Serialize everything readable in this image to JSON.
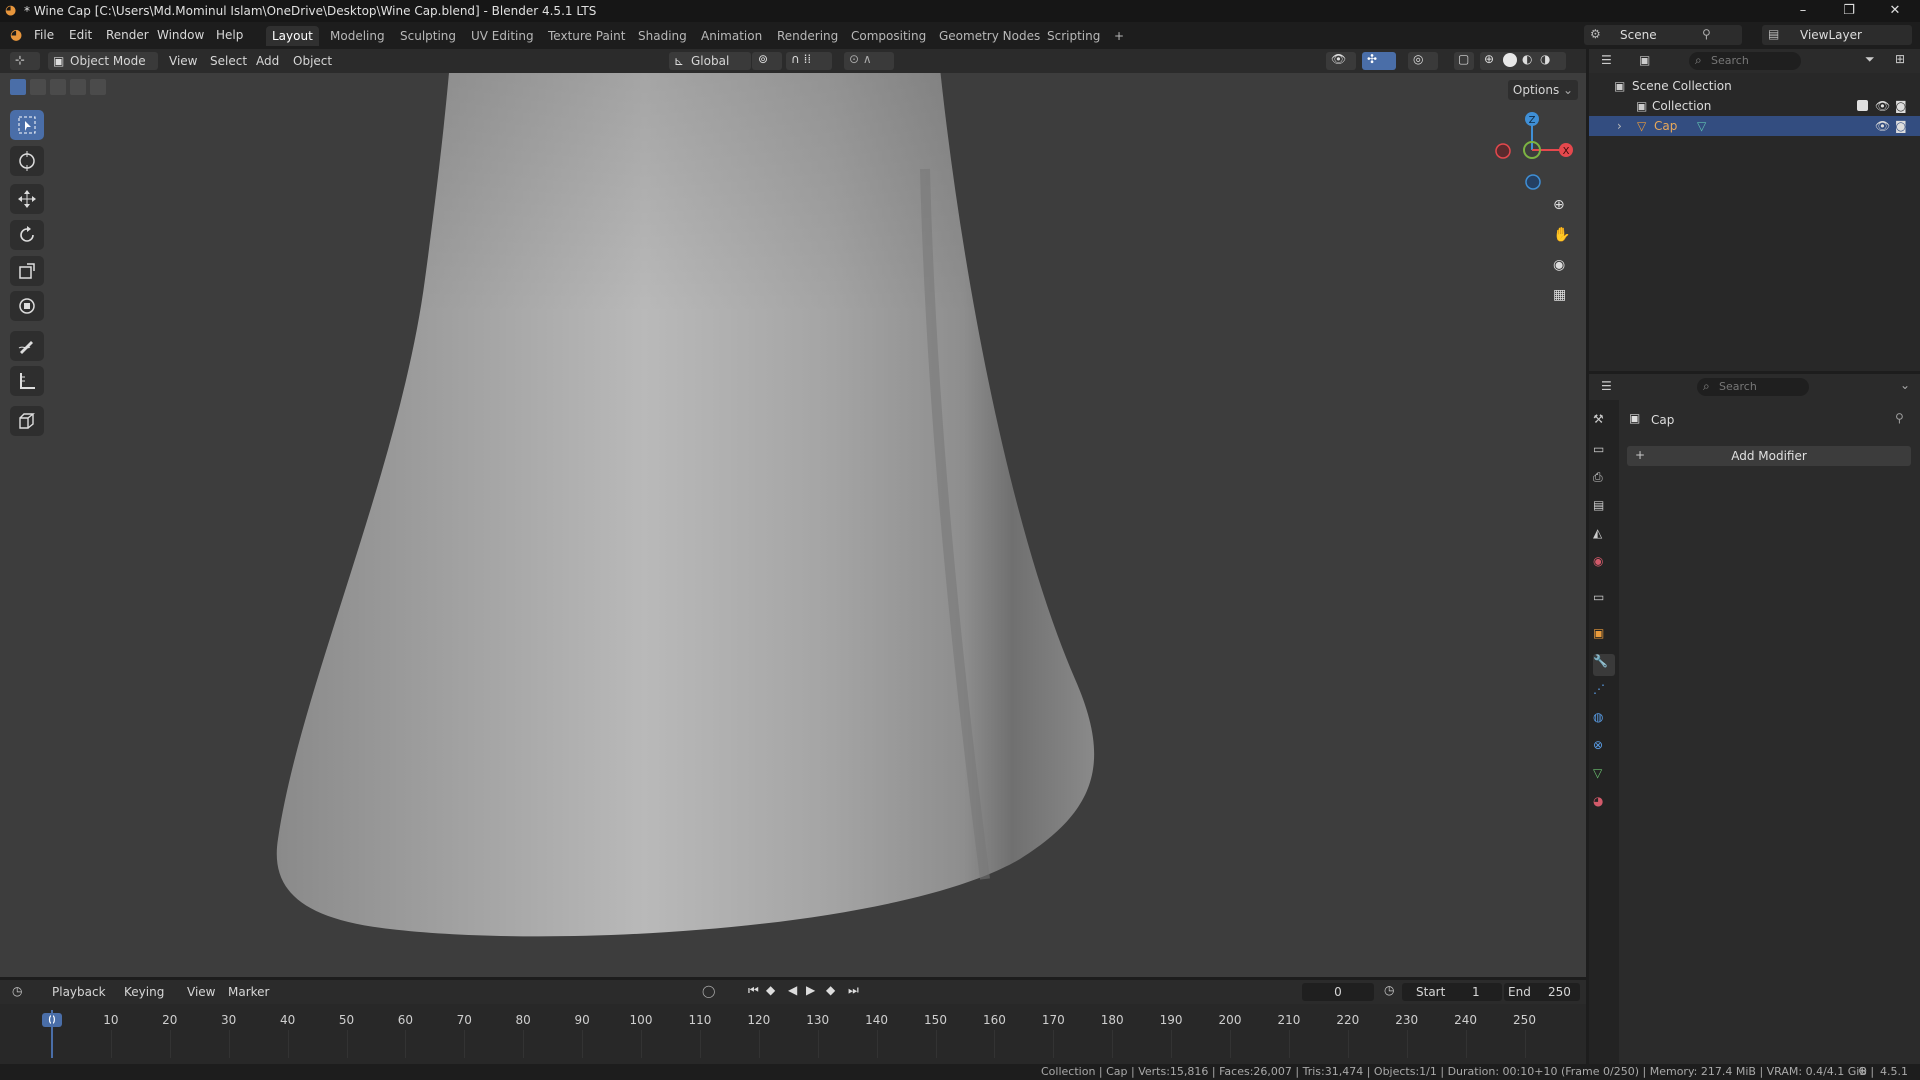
{
  "window": {
    "title": "* Wine Cap [C:\\Users\\Md.Mominul Islam\\OneDrive\\Desktop\\Wine Cap.blend] - Blender 4.5.1 LTS",
    "controls": [
      "–",
      "❐",
      "✕"
    ]
  },
  "menubar": {
    "menus": [
      "File",
      "Edit",
      "Render",
      "Window",
      "Help"
    ],
    "workspaces": [
      "Layout",
      "Modeling",
      "Sculpting",
      "UV Editing",
      "Texture Paint",
      "Shading",
      "Animation",
      "Rendering",
      "Compositing",
      "Geometry Nodes",
      "Scripting"
    ],
    "add_workspace": "+",
    "scene": "Scene",
    "view_layer": "ViewLayer"
  },
  "viewport": {
    "mode": "Object Mode",
    "menus": [
      "View",
      "Select",
      "Add",
      "Object"
    ],
    "orientation": "Global",
    "options_label": "Options",
    "gizmo_axes": {
      "x": "X",
      "y": "Y",
      "z": "Z"
    },
    "colors": {
      "x_axis": "#e5484d",
      "y_axis": "#7cb342",
      "z_axis": "#3f8fd6",
      "background": "#3d3d3d",
      "active_tool": "#4a6ea8"
    }
  },
  "toolbar": {
    "tools": [
      "select-box-icon",
      "cursor-icon",
      "move-icon",
      "rotate-icon",
      "scale-icon",
      "transform-icon",
      "annotate-icon",
      "measure-icon",
      "add-cube-icon"
    ]
  },
  "outliner": {
    "search_placeholder": "Search",
    "rows": [
      {
        "label": "Scene Collection"
      },
      {
        "label": "Collection"
      },
      {
        "label": "Cap"
      }
    ]
  },
  "properties": {
    "search_placeholder": "Search",
    "object_name": "Cap",
    "add_modifier_label": "Add Modifier",
    "add_modifier_plus": "+"
  },
  "timeline": {
    "menus": [
      "Playback",
      "Keying",
      "View",
      "Marker"
    ],
    "current_frame": "0",
    "start_label": "Start",
    "start_value": "1",
    "end_label": "End",
    "end_value": "250",
    "ticks": [
      "0",
      "10",
      "20",
      "30",
      "40",
      "50",
      "60",
      "70",
      "80",
      "90",
      "100",
      "110",
      "120",
      "130",
      "140",
      "150",
      "160",
      "170",
      "180",
      "190",
      "200",
      "210",
      "220",
      "230",
      "240",
      "250"
    ]
  },
  "statusbar": {
    "text": "Collection | Cap | Verts:15,816 | Faces:26,007 | Tris:31,474 | Objects:1/1 | Duration: 00:10+10 (Frame 0/250) | Memory: 217.4 MiB | VRAM: 0.4/4.1 GiB |",
    "version": "4.5.1"
  }
}
